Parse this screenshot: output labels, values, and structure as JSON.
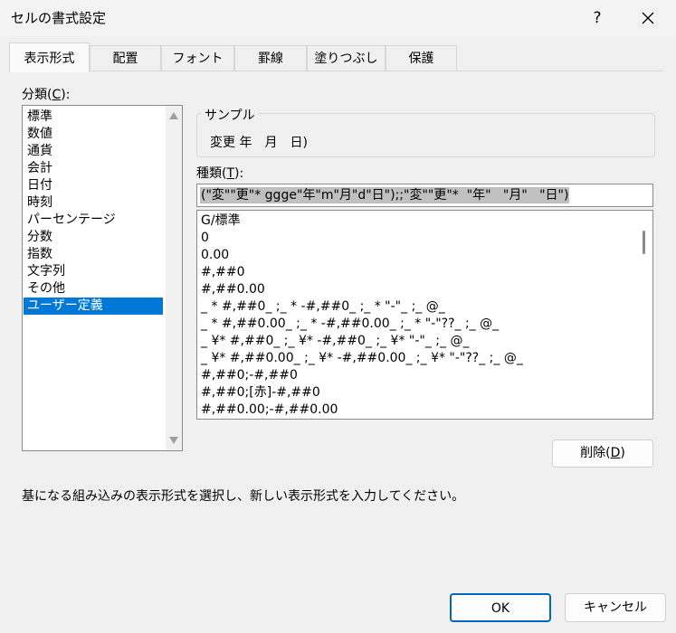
{
  "window": {
    "title": "セルの書式設定",
    "help_glyph": "?",
    "close_icon": "close-icon"
  },
  "tabs": [
    {
      "label": "表示形式",
      "active": true
    },
    {
      "label": "配置",
      "active": false
    },
    {
      "label": "フォント",
      "active": false
    },
    {
      "label": "罫線",
      "active": false
    },
    {
      "label": "塗りつぶし",
      "active": false
    },
    {
      "label": "保護",
      "active": false
    }
  ],
  "category": {
    "label_prefix": "分類(",
    "label_key": "C",
    "label_suffix": "):",
    "items": [
      "標準",
      "数値",
      "通貨",
      "会計",
      "日付",
      "時刻",
      "パーセンテージ",
      "分数",
      "指数",
      "文字列",
      "その他",
      "ユーザー定義"
    ],
    "selected": "ユーザー定義"
  },
  "sample": {
    "label": "サンプル",
    "value": "変更 年　月　日)"
  },
  "type": {
    "label_prefix": "種類(",
    "label_key": "T",
    "label_suffix": "):",
    "value": "(\"変\"\"更\"* ggge\"年\"m\"月\"d\"日\");;\"変\"\"更\"*  \"年\"   \"月\"   \"日\")"
  },
  "formats": [
    "G/標準",
    "0",
    "0.00",
    "#,##0",
    "#,##0.00",
    "_ * #,##0_ ;_ * -#,##0_ ;_ * \"-\"_ ;_ @_",
    "_ * #,##0.00_ ;_ * -#,##0.00_ ;_ * \"-\"??_ ;_ @_",
    "_ ¥* #,##0_ ;_ ¥* -#,##0_ ;_ ¥* \"-\"_ ;_ @_",
    "_ ¥* #,##0.00_ ;_ ¥* -#,##0.00_ ;_ ¥* \"-\"??_ ;_ @_",
    "#,##0;-#,##0",
    "#,##0;[赤]-#,##0",
    "#,##0.00;-#,##0.00"
  ],
  "buttons": {
    "delete_prefix": "削除(",
    "delete_key": "D",
    "delete_suffix": ")",
    "ok": "OK",
    "cancel": "キャンセル"
  },
  "description": "基になる組み込みの表示形式を選択し、新しい表示形式を入力してください。",
  "colors": {
    "selection": "#0078d7",
    "ok_border": "#0067c0",
    "background": "#f0f0f0"
  }
}
